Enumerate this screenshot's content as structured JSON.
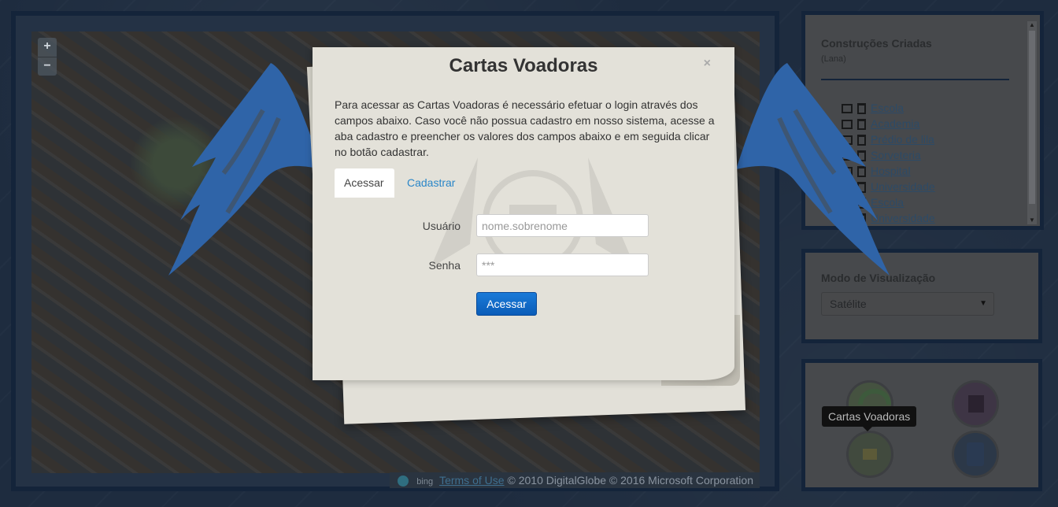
{
  "map": {
    "zoom_in": "+",
    "zoom_out": "−",
    "attribution": {
      "bing": "bing",
      "terms": "Terms of Use",
      "copyright": "© 2010 DigitalGlobe © 2016 Microsoft Corporation"
    }
  },
  "constructions": {
    "title": "Construções Criadas",
    "subtitle": "(Lana)",
    "items": [
      {
        "label": "Escola"
      },
      {
        "label": "Academia"
      },
      {
        "label": "Prédio de lila"
      },
      {
        "label": "Sorveteria"
      },
      {
        "label": "Hospital"
      },
      {
        "label": "Universidade"
      },
      {
        "label": "Escola"
      },
      {
        "label": "Universidade"
      }
    ]
  },
  "view_mode": {
    "title": "Modo de Visualização",
    "selected": "Satélite"
  },
  "actions": {
    "tooltip": "Cartas Voadoras"
  },
  "modal": {
    "title": "Cartas Voadoras",
    "close": "×",
    "description": "Para acessar as Cartas Voadoras é necessário efetuar o login através dos campos abaixo. Caso você não possua cadastro em nosso sistema, acesse a aba cadastro e preencher os valores dos campos abaixo e em seguida clicar no botão cadastrar.",
    "tabs": [
      {
        "label": "Acessar",
        "active": true
      },
      {
        "label": "Cadastrar",
        "active": false
      }
    ],
    "user_label": "Usuário",
    "user_placeholder": "nome.sobrenome",
    "pass_label": "Senha",
    "pass_placeholder": "***",
    "submit": "Acessar"
  },
  "colors": {
    "wing": "#2f64a8",
    "primary_button": "#0a5cb8",
    "link": "#2a86c8",
    "panel_border": "#14243a"
  }
}
